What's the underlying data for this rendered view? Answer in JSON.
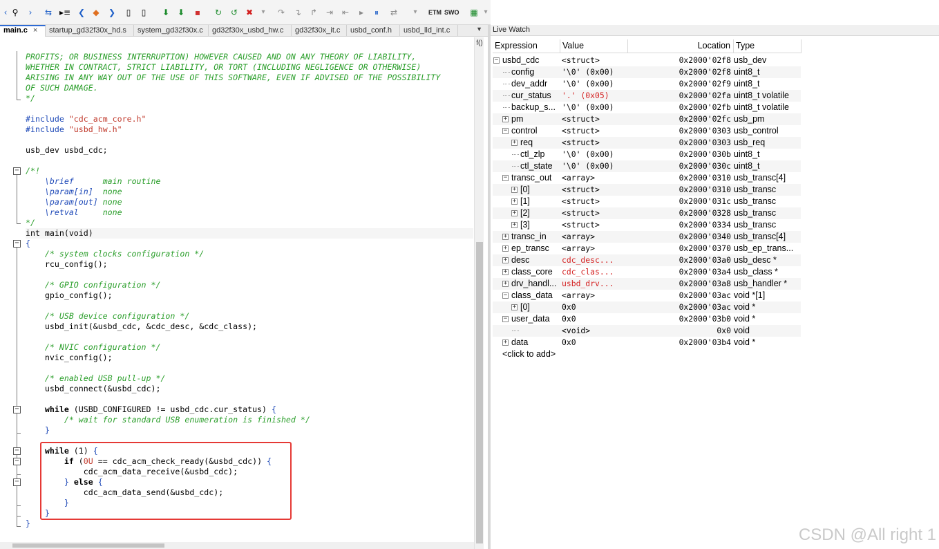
{
  "toolbar": {
    "icons": [
      "back-arrow-icon",
      "find-icon",
      "forward-arrow-icon",
      "swap-icon",
      "list-go-icon",
      "nav-back-icon",
      "bookmark-icon",
      "nav-forward-icon",
      "file-back-icon",
      "file-forward-icon",
      "download-icon",
      "download-green-icon",
      "trace-icon",
      "go-icon",
      "reset-icon",
      "stop-icon",
      "step-over-icon",
      "step-into-icon",
      "step-out-icon",
      "next-statement-icon",
      "run-to-cursor-icon",
      "run-icon",
      "break-icon",
      "restart-icon",
      "dropdown-icon",
      "chip-icon",
      "dropdown-icon"
    ],
    "etm_label": "ETM",
    "swo_label": "SWO"
  },
  "editor": {
    "tabs": [
      {
        "label": "main.c",
        "close": "×",
        "active": true
      },
      {
        "label": "startup_gd32f30x_hd.s"
      },
      {
        "label": "system_gd32f30x.c"
      },
      {
        "label": "gd32f30x_usbd_hw.c"
      },
      {
        "label": "gd32f30x_it.c"
      },
      {
        "label": "usbd_conf.h"
      },
      {
        "label": "usbd_lld_int.c"
      }
    ],
    "tabs_dropdown": "▼",
    "func_nav": "f()"
  },
  "live_watch": {
    "title": "Live Watch",
    "columns": [
      "Expression",
      "Value",
      "Location",
      "Type"
    ],
    "rows": [
      {
        "level": 0,
        "toggle": "−",
        "expr": "usbd_cdc",
        "value": "<struct>",
        "loc": "0x2000'02f8",
        "type": "usb_dev"
      },
      {
        "level": 1,
        "toggle": "",
        "expr": "config",
        "value": "'\\0' (0x00)",
        "loc": "0x2000'02f8",
        "type": "uint8_t"
      },
      {
        "level": 1,
        "toggle": "",
        "expr": "dev_addr",
        "value": "'\\0' (0x00)",
        "loc": "0x2000'02f9",
        "type": "uint8_t"
      },
      {
        "level": 1,
        "toggle": "",
        "expr": "cur_status",
        "value": "'.' (0x05)",
        "value_red": true,
        "loc": "0x2000'02fa",
        "type": "uint8_t volatile"
      },
      {
        "level": 1,
        "toggle": "",
        "expr": "backup_s...",
        "value": "'\\0' (0x00)",
        "loc": "0x2000'02fb",
        "type": "uint8_t volatile"
      },
      {
        "level": 1,
        "toggle": "+",
        "expr": "pm",
        "value": "<struct>",
        "loc": "0x2000'02fc",
        "type": "usb_pm"
      },
      {
        "level": 1,
        "toggle": "−",
        "expr": "control",
        "value": "<struct>",
        "loc": "0x2000'0303",
        "type": "usb_control"
      },
      {
        "level": 2,
        "toggle": "+",
        "expr": "req",
        "value": "<struct>",
        "loc": "0x2000'0303",
        "type": "usb_req"
      },
      {
        "level": 2,
        "toggle": "",
        "expr": "ctl_zlp",
        "value": "'\\0' (0x00)",
        "loc": "0x2000'030b",
        "type": "uint8_t"
      },
      {
        "level": 2,
        "toggle": "",
        "expr": "ctl_state",
        "value": "'\\0' (0x00)",
        "loc": "0x2000'030c",
        "type": "uint8_t"
      },
      {
        "level": 1,
        "toggle": "−",
        "expr": "transc_out",
        "value": "<array>",
        "loc": "0x2000'0310",
        "type": "usb_transc[4]"
      },
      {
        "level": 2,
        "toggle": "+",
        "expr": "[0]",
        "value": "<struct>",
        "loc": "0x2000'0310",
        "type": "usb_transc"
      },
      {
        "level": 2,
        "toggle": "+",
        "expr": "[1]",
        "value": "<struct>",
        "loc": "0x2000'031c",
        "type": "usb_transc"
      },
      {
        "level": 2,
        "toggle": "+",
        "expr": "[2]",
        "value": "<struct>",
        "loc": "0x2000'0328",
        "type": "usb_transc"
      },
      {
        "level": 2,
        "toggle": "+",
        "expr": "[3]",
        "value": "<struct>",
        "loc": "0x2000'0334",
        "type": "usb_transc"
      },
      {
        "level": 1,
        "toggle": "+",
        "expr": "transc_in",
        "value": "<array>",
        "loc": "0x2000'0340",
        "type": "usb_transc[4]"
      },
      {
        "level": 1,
        "toggle": "+",
        "expr": "ep_transc",
        "value": "<array>",
        "loc": "0x2000'0370",
        "type": "usb_ep_trans..."
      },
      {
        "level": 1,
        "toggle": "+",
        "expr": "desc",
        "value": "cdc_desc...",
        "value_red": true,
        "loc": "0x2000'03a0",
        "type": "usb_desc *"
      },
      {
        "level": 1,
        "toggle": "+",
        "expr": "class_core",
        "value": "cdc_clas...",
        "value_red": true,
        "loc": "0x2000'03a4",
        "type": "usb_class *"
      },
      {
        "level": 1,
        "toggle": "+",
        "expr": "drv_handl...",
        "value": "usbd_drv...",
        "value_red": true,
        "loc": "0x2000'03a8",
        "type": "usb_handler *"
      },
      {
        "level": 1,
        "toggle": "−",
        "expr": "class_data",
        "value": "<array>",
        "loc": "0x2000'03ac",
        "type": "void *[1]"
      },
      {
        "level": 2,
        "toggle": "+",
        "expr": "[0]",
        "value": "0x0",
        "loc": "0x2000'03ac",
        "type": "void *"
      },
      {
        "level": 1,
        "toggle": "−",
        "expr": "user_data",
        "value": "0x0",
        "loc": "0x2000'03b0",
        "type": "void *"
      },
      {
        "level": 2,
        "toggle": "",
        "expr": "",
        "value": "<void>",
        "loc": "0x0",
        "type": "void"
      },
      {
        "level": 1,
        "toggle": "+",
        "expr": "data",
        "value": "0x0",
        "loc": "0x2000'03b4",
        "type": "void *"
      }
    ],
    "add_row": "<click to add>"
  },
  "watermark": "CSDN @All right 1"
}
